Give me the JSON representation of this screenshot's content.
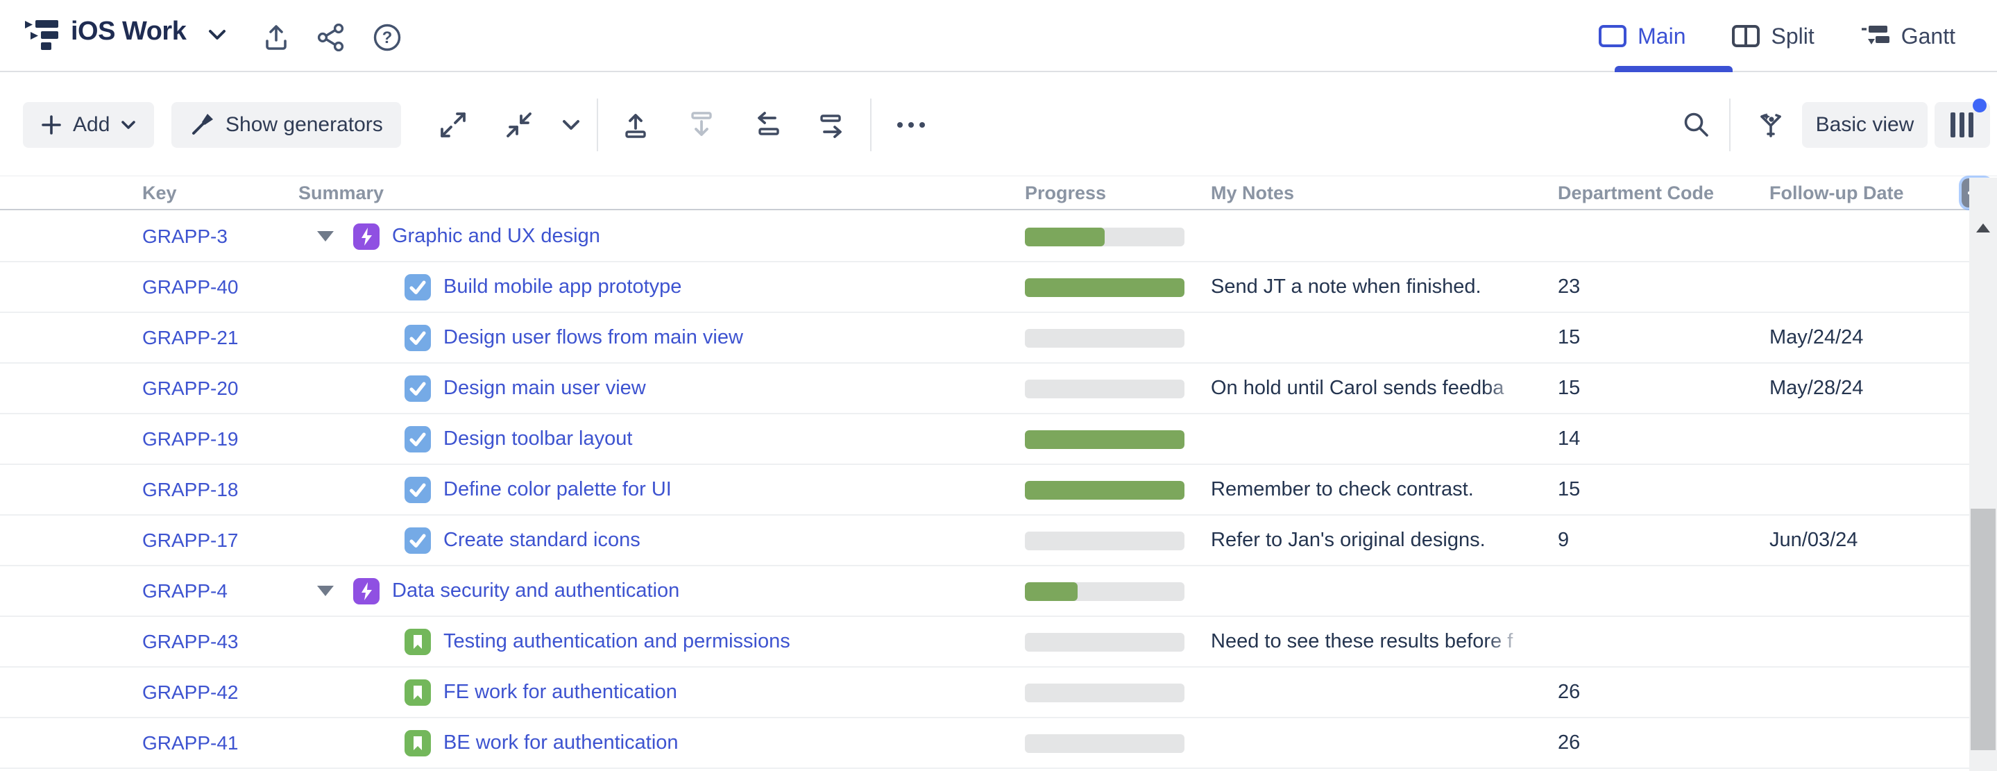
{
  "app": {
    "title": "iOS Work"
  },
  "view_tabs": [
    {
      "label": "Main",
      "active": true
    },
    {
      "label": "Split",
      "active": false
    },
    {
      "label": "Gantt",
      "active": false
    }
  ],
  "toolbar": {
    "add_label": "Add",
    "show_generators_label": "Show generators",
    "basic_view_label": "Basic view",
    "icons": [
      "plus",
      "chevron-down",
      "magic-wand",
      "expand-all",
      "collapse-all",
      "move-up",
      "move-down",
      "outdent",
      "indent",
      "more-options",
      "search",
      "transformations",
      "columns"
    ],
    "columns_notification_dot": true
  },
  "header_icons": [
    "structure-logo",
    "chevron-down",
    "export",
    "share",
    "help"
  ],
  "table": {
    "columns": {
      "key": "Key",
      "summary": "Summary",
      "progress": "Progress",
      "notes": "My Notes",
      "dept": "Department Code",
      "date": "Follow-up Date"
    },
    "rows": [
      {
        "key": "GRAPP-3",
        "type": "epic",
        "summary": "Graphic and UX design",
        "progress": 50,
        "note": "",
        "note_truncated": false,
        "dept": "",
        "date": ""
      },
      {
        "key": "GRAPP-40",
        "type": "task",
        "summary": "Build mobile app prototype",
        "progress": 100,
        "note": "Send JT a note when finished.",
        "note_truncated": false,
        "dept": "23",
        "date": ""
      },
      {
        "key": "GRAPP-21",
        "type": "task",
        "summary": "Design user flows from main view",
        "progress": 0,
        "note": "",
        "note_truncated": false,
        "dept": "15",
        "date": "May/24/24"
      },
      {
        "key": "GRAPP-20",
        "type": "task",
        "summary": "Design main user view",
        "progress": 0,
        "note": "On hold until Carol sends feedba",
        "note_truncated": true,
        "dept": "15",
        "date": "May/28/24"
      },
      {
        "key": "GRAPP-19",
        "type": "task",
        "summary": "Design toolbar layout",
        "progress": 100,
        "note": "",
        "note_truncated": false,
        "dept": "14",
        "date": ""
      },
      {
        "key": "GRAPP-18",
        "type": "task",
        "summary": "Define color palette for UI",
        "progress": 100,
        "note": "Remember to check contrast.",
        "note_truncated": false,
        "dept": "15",
        "date": ""
      },
      {
        "key": "GRAPP-17",
        "type": "task",
        "summary": "Create standard icons",
        "progress": 0,
        "note": "Refer to Jan's original designs.",
        "note_truncated": false,
        "dept": "9",
        "date": "Jun/03/24"
      },
      {
        "key": "GRAPP-4",
        "type": "epic",
        "summary": "Data security and authentication",
        "progress": 33,
        "note": "",
        "note_truncated": false,
        "dept": "",
        "date": ""
      },
      {
        "key": "GRAPP-43",
        "type": "story",
        "summary": "Testing authentication and permissions",
        "progress": 0,
        "note": "Need to see these results before f",
        "note_truncated": true,
        "dept": "",
        "date": ""
      },
      {
        "key": "GRAPP-42",
        "type": "story",
        "summary": "FE work for authentication",
        "progress": 0,
        "note": "",
        "note_truncated": false,
        "dept": "26",
        "date": ""
      },
      {
        "key": "GRAPP-41",
        "type": "story",
        "summary": "BE work for authentication",
        "progress": 0,
        "note": "",
        "note_truncated": false,
        "dept": "26",
        "date": ""
      }
    ]
  },
  "colors": {
    "link_blue": "#3D53D0",
    "active_tab_blue": "#3B51D4",
    "epic_purple": "#8F50E2",
    "task_blue": "#75AAE6",
    "story_green": "#73B75B",
    "progress_green": "#7CA75C",
    "notification_dot_blue": "#3E66F7"
  }
}
